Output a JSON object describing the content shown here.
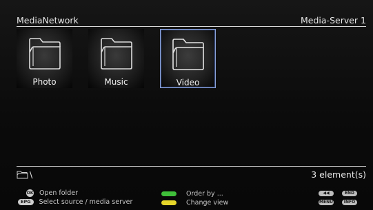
{
  "header": {
    "title": "MediaNetwork",
    "server": "Media-Server 1"
  },
  "tiles": [
    {
      "label": "Photo",
      "selected": false,
      "icon": "folder-icon"
    },
    {
      "label": "Music",
      "selected": false,
      "icon": "folder-icon"
    },
    {
      "label": "Video",
      "selected": true,
      "icon": "folder-icon"
    }
  ],
  "pathbar": {
    "path": "\\",
    "count": "3 element(s)"
  },
  "legend": {
    "ok_badge": "OK",
    "open_folder": "Open folder",
    "epg_badge": "EPG",
    "select_source": "Select source / media server",
    "order_by": "Order by ...",
    "change_view": "Change view",
    "rewind_badge": "◀◀",
    "end_badge": "END",
    "menu_badge": "MENU",
    "info_badge": "INFO"
  },
  "colors": {
    "selection_border": "#8aa2d8",
    "green_key": "#3fbf3a",
    "yellow_key": "#e6d62a"
  }
}
